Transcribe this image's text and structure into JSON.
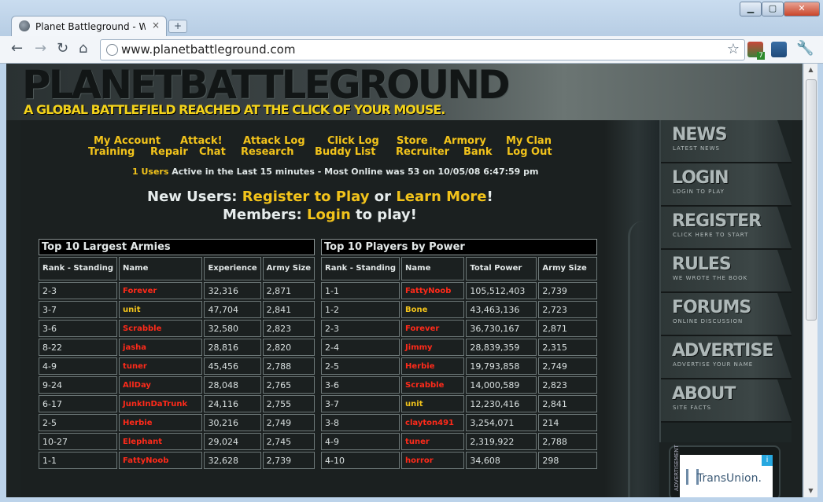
{
  "browser": {
    "tab_title": "Planet Battleground - World",
    "tab_close": "×",
    "new_tab": "+",
    "url": "www.planetbattleground.com",
    "ext_badge": "7"
  },
  "site": {
    "title": "PLANETBATTLEGROUND",
    "tagline": "A GLOBAL BATTLEFIELD REACHED AT THE CLICK OF YOUR MOUSE."
  },
  "menu": {
    "row1": [
      "My Account",
      "Attack!",
      "Attack Log",
      "Click Log",
      "Store",
      "Armory",
      "My Clan"
    ],
    "row2": [
      "Training",
      "Repair",
      "Chat",
      "Research",
      "Buddy List",
      "Recruiter",
      "Bank",
      "Log Out"
    ]
  },
  "online": {
    "users": "1 Users",
    "rest": " Active in the Last 15 minutes - Most Online was 53 on 10/05/08 6:47:59 pm"
  },
  "promo": {
    "new_users_label": "New Users:",
    "register": "Register to Play",
    "or": "or",
    "learn_more": "Learn More",
    "bang": "!",
    "members_label": "Members:",
    "login": "Login",
    "to_play": "to play!"
  },
  "armies_table": {
    "caption": "Top 10 Largest Armies",
    "headers": [
      "Rank - Standing",
      "Name",
      "Experience",
      "Army Size"
    ],
    "rows": [
      [
        "2-3",
        "Forever",
        "32,316",
        "2,871"
      ],
      [
        "3-7",
        "unit",
        "47,704",
        "2,841"
      ],
      [
        "3-6",
        "Scrabble",
        "32,580",
        "2,823"
      ],
      [
        "8-22",
        "jasha",
        "28,816",
        "2,820"
      ],
      [
        "4-9",
        "tuner",
        "45,456",
        "2,788"
      ],
      [
        "9-24",
        "AllDay",
        "28,048",
        "2,765"
      ],
      [
        "6-17",
        "JunkInDaTrunk",
        "24,116",
        "2,755"
      ],
      [
        "2-5",
        "Herbie",
        "30,216",
        "2,749"
      ],
      [
        "10-27",
        "Elephant",
        "29,024",
        "2,745"
      ],
      [
        "1-1",
        "FattyNoob",
        "32,628",
        "2,739"
      ]
    ]
  },
  "power_table": {
    "caption": "Top 10 Players by Power",
    "headers": [
      "Rank - Standing",
      "Name",
      "Total Power",
      "Army Size"
    ],
    "rows": [
      [
        "1-1",
        "FattyNoob",
        "105,512,403",
        "2,739"
      ],
      [
        "1-2",
        "Bone",
        "43,463,136",
        "2,723"
      ],
      [
        "2-3",
        "Forever",
        "36,730,167",
        "2,871"
      ],
      [
        "2-4",
        "Jimmy",
        "28,839,359",
        "2,315"
      ],
      [
        "2-5",
        "Herbie",
        "19,793,858",
        "2,749"
      ],
      [
        "3-6",
        "Scrabble",
        "14,000,589",
        "2,823"
      ],
      [
        "3-7",
        "unit",
        "12,230,416",
        "2,841"
      ],
      [
        "3-8",
        "clayton491",
        "3,254,071",
        "214"
      ],
      [
        "4-9",
        "tuner",
        "2,319,922",
        "2,788"
      ],
      [
        "4-10",
        "horror",
        "34,608",
        "298"
      ]
    ]
  },
  "sidebar": {
    "items": [
      {
        "title": "NEWS",
        "sub": "LATEST NEWS"
      },
      {
        "title": "LOGIN",
        "sub": "LOGIN TO PLAY"
      },
      {
        "title": "REGISTER",
        "sub": "CLICK HERE TO START"
      },
      {
        "title": "RULES",
        "sub": "WE WROTE THE BOOK"
      },
      {
        "title": "FORUMS",
        "sub": "ONLINE DISCUSSION"
      },
      {
        "title": "ADVERTISE",
        "sub": "ADVERTISE YOUR NAME"
      },
      {
        "title": "ABOUT",
        "sub": "SITE FACTS"
      }
    ]
  },
  "ad": {
    "label": "ADVERTISEMENT",
    "text": "TransUnion.",
    "info": "i"
  },
  "name_colors": {
    "red": "#ff2a1a",
    "gold": "#f2c31b"
  }
}
